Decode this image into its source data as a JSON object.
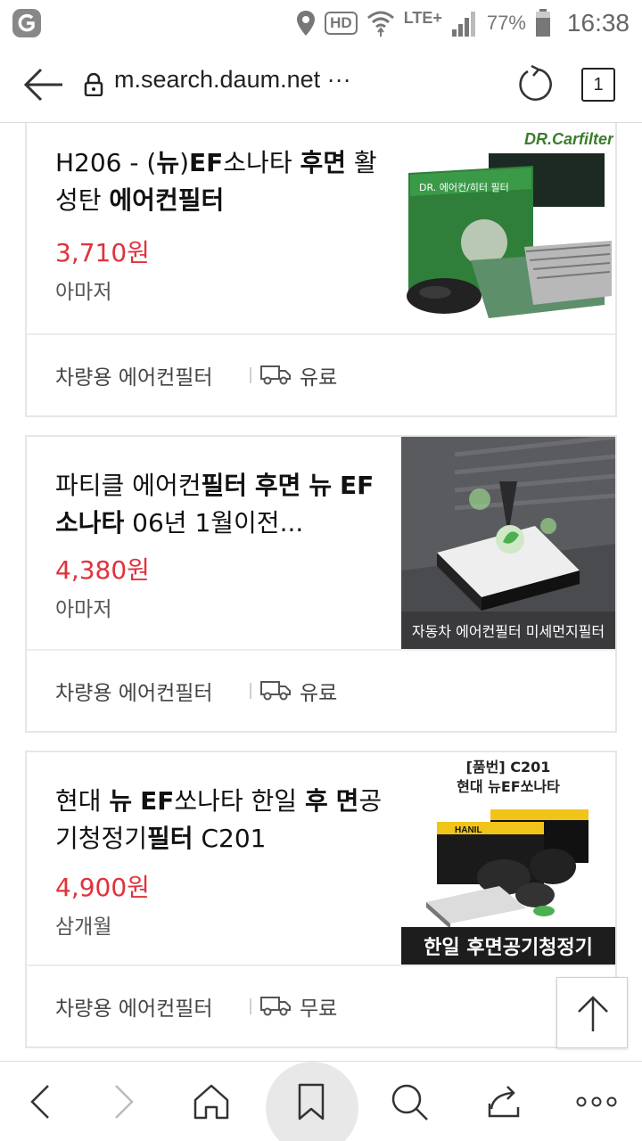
{
  "status_bar": {
    "battery_percent": "77%",
    "clock": "16:38",
    "hd_label": "HD",
    "network_label": "LTE+",
    "icons": [
      "app-logo-icon",
      "location-icon",
      "hd-voice-icon",
      "wifi-icon",
      "lte-icon",
      "signal-icon",
      "battery-icon"
    ]
  },
  "url_bar": {
    "url": "m.search.daum.net ···",
    "tab_count": "1"
  },
  "products": [
    {
      "title_parts": [
        "H206 - (",
        "뉴",
        ")",
        "EF",
        "소나타 ",
        "후면",
        " 활성탄 ",
        "에어컨필터"
      ],
      "price": "3,710원",
      "seller": "아마저",
      "category": "차량용 에어컨필터",
      "shipping": "유료",
      "image_text": [
        "DR.Carfilter",
        "DR. 에어컨/히터 필터"
      ]
    },
    {
      "title_parts": [
        "파티클 에어컨",
        "필터",
        " ",
        "후면",
        " ",
        "뉴",
        " ",
        "EF소나타",
        " 06년 1월이전..."
      ],
      "price": "4,380원",
      "seller": "아마저",
      "category": "차량용 에어컨필터",
      "shipping": "유료",
      "image_text": [
        "자동차 에어컨필터 미세먼지필터"
      ]
    },
    {
      "title_parts": [
        "현대 ",
        "뉴",
        " ",
        "EF",
        "쏘나타 한일 ",
        "후",
        " ",
        "면",
        "공기청정기",
        "필터",
        " C201"
      ],
      "price": "4,900원",
      "seller": "삼개월",
      "category": "차량용 에어컨필터",
      "shipping": "무료",
      "image_text": [
        "[품번] C201",
        "현대 뉴EF쏘나타",
        "HANIL",
        "한일 후면공기청정기"
      ]
    }
  ],
  "colors": {
    "price": "#e0323c",
    "border": "#e6e6e6"
  }
}
